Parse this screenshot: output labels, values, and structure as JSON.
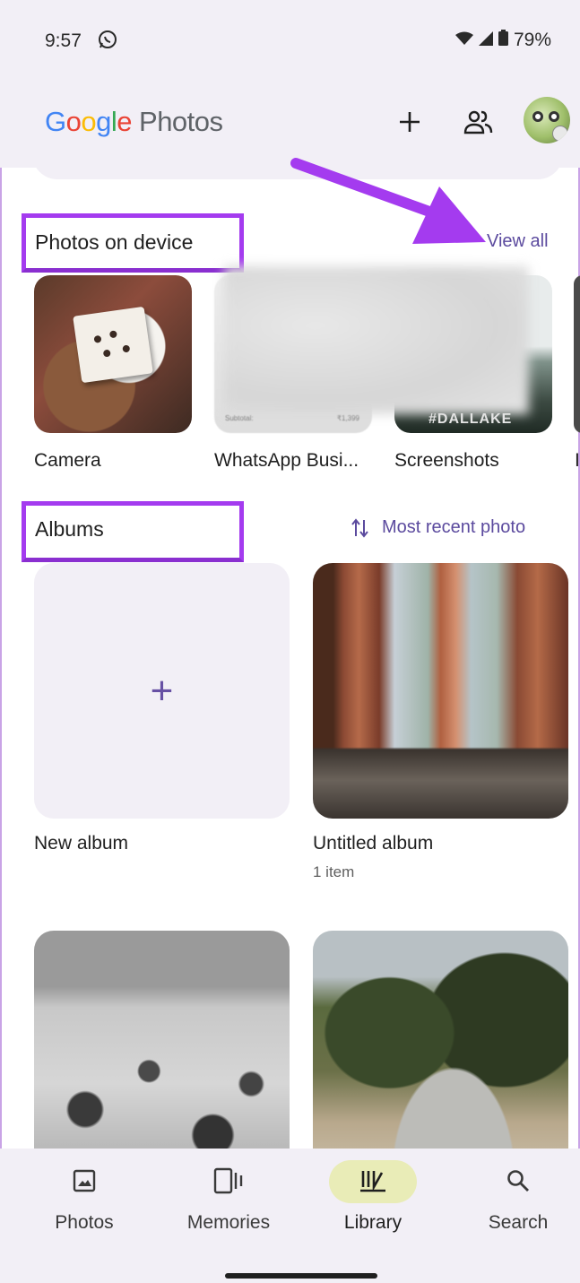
{
  "status_bar": {
    "time": "9:57",
    "battery": "79%"
  },
  "header": {
    "logo_google": "Google",
    "logo_photos": "Photos"
  },
  "photos_on_device": {
    "title": "Photos on device",
    "view_all": "View all",
    "folders": [
      {
        "label": "Camera"
      },
      {
        "label": "WhatsApp Busi..."
      },
      {
        "label": "Screenshots"
      },
      {
        "label": "I"
      }
    ],
    "subtotal_label": "Subtotal:",
    "subtotal_value": "₹1,399",
    "screenshot_caption": "#DALLAKE"
  },
  "albums": {
    "title": "Albums",
    "sort_label": "Most recent photo",
    "new_album_label": "New album",
    "items": [
      {
        "label": "Untitled album",
        "sub": "1 item"
      }
    ]
  },
  "nav": [
    {
      "label": "Photos",
      "icon": "photo-icon"
    },
    {
      "label": "Memories",
      "icon": "memories-icon"
    },
    {
      "label": "Library",
      "icon": "library-icon",
      "active": true
    },
    {
      "label": "Search",
      "icon": "search-icon"
    }
  ],
  "colors": {
    "accent": "#6750a4",
    "highlight": "#a43bef",
    "active_pill": "#e9ecb7",
    "surface": "#f2eff6"
  }
}
